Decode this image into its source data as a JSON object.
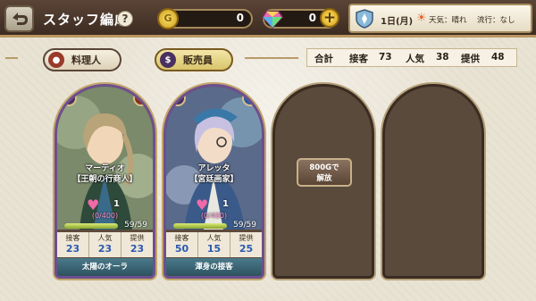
{
  "header": {
    "title": "スタッフ編成",
    "help": "?"
  },
  "currency": {
    "coins": "0",
    "gems": "0",
    "coin_icon": "coin-icon",
    "gem_icon": "gem-icon"
  },
  "status": {
    "day": "1日(月)",
    "weather": "天気：晴れ",
    "trend": "流行：なし"
  },
  "tabs": [
    {
      "label": "料理人",
      "icon": "frying-pan-icon",
      "active": false
    },
    {
      "label": "販売員",
      "icon": "money-bag-icon",
      "active": true
    }
  ],
  "totals": {
    "label": "合計",
    "serve_label": "接客",
    "serve": "73",
    "pop_label": "人気",
    "pop": "38",
    "supply_label": "提供",
    "supply": "48"
  },
  "cards": [
    {
      "name": "マーティオ",
      "role": "【王朝の行商人】",
      "hearts": "1",
      "favor": "(0/400)",
      "stamina": "59/59",
      "stamina_ratio": 1.0,
      "stats": [
        {
          "label": "接客",
          "value": "23"
        },
        {
          "label": "人気",
          "value": "23"
        },
        {
          "label": "提供",
          "value": "23"
        }
      ],
      "skill": "太陽のオーラ",
      "badge_color": "#8a3018"
    },
    {
      "name": "アレッタ",
      "role": "【宮廷画家】",
      "hearts": "1",
      "favor": "(0/400)",
      "stamina": "59/59",
      "stamina_ratio": 1.0,
      "stats": [
        {
          "label": "接客",
          "value": "50"
        },
        {
          "label": "人気",
          "value": "15"
        },
        {
          "label": "提供",
          "value": "25"
        }
      ],
      "skill": "渾身の接客",
      "badge_color": "#2a5aa0"
    }
  ],
  "locked_slot": {
    "label": "800Gで\n解放"
  }
}
